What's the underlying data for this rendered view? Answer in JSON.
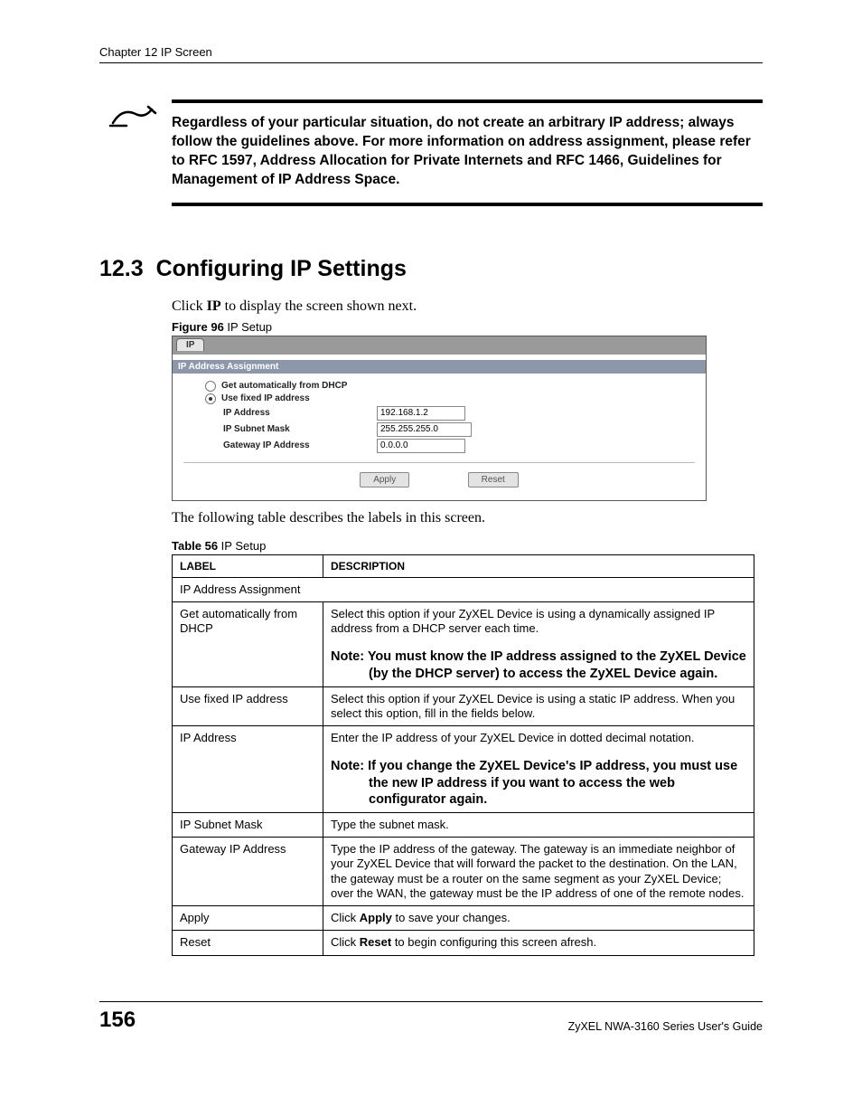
{
  "header": {
    "chapter": "Chapter 12 IP Screen"
  },
  "callout": {
    "text": "Regardless of your particular situation, do not create an arbitrary IP address; always follow the guidelines above. For more information on address assignment, please refer to RFC 1597, Address Allocation for Private Internets and RFC 1466, Guidelines for Management of IP Address Space."
  },
  "section": {
    "number": "12.3",
    "title": "Configuring IP Settings",
    "intro_pre": "Click ",
    "intro_bold": "IP",
    "intro_post": " to display the screen shown next."
  },
  "figure": {
    "caption_bold": "Figure 96",
    "caption_rest": "   IP Setup",
    "tab": "IP",
    "subheader": "IP Address Assignment",
    "radio1": "Get automatically from DHCP",
    "radio2": "Use fixed IP address",
    "field1_label": "IP Address",
    "field1_value": "192.168.1.2",
    "field2_label": "IP Subnet Mask",
    "field2_value": "255.255.255.0",
    "field3_label": "Gateway IP Address",
    "field3_value": "0.0.0.0",
    "btn_apply": "Apply",
    "btn_reset": "Reset"
  },
  "table_intro": "The following table describes the labels in this screen.",
  "table": {
    "caption_bold": "Table 56",
    "caption_rest": "   IP Setup",
    "head_label": "LABEL",
    "head_desc": "DESCRIPTION",
    "rows": {
      "span1": "IP Address Assignment",
      "r1_label": "Get automatically from DHCP",
      "r1_desc": "Select this option if your ZyXEL Device is using a dynamically assigned IP address from a DHCP server each time.",
      "r1_note": "Note: You must know the IP address assigned to the ZyXEL Device (by the DHCP server) to access the ZyXEL Device again.",
      "r2_label": "Use fixed IP address",
      "r2_desc": "Select this option if your ZyXEL Device is using a static IP address. When you select this option, fill in the fields below.",
      "r3_label": "IP Address",
      "r3_desc": "Enter the IP address of your ZyXEL Device in dotted decimal notation.",
      "r3_note": "Note: If you change the ZyXEL Device's IP address, you must use the new IP address if you want to access the web configurator again.",
      "r4_label": "IP Subnet Mask",
      "r4_desc": "Type the subnet mask.",
      "r5_label": "Gateway IP Address",
      "r5_desc": "Type the IP address of the gateway. The gateway is an immediate neighbor of your ZyXEL Device that will forward the packet to the destination. On the LAN, the gateway must be a router on the same segment as your ZyXEL Device; over the WAN, the gateway must be the IP address of one of the remote nodes.",
      "r6_label": "Apply",
      "r6_desc_pre": "Click ",
      "r6_desc_bold": "Apply",
      "r6_desc_post": " to save your changes.",
      "r7_label": "Reset",
      "r7_desc_pre": "Click ",
      "r7_desc_bold": "Reset",
      "r7_desc_post": " to begin configuring this screen afresh."
    }
  },
  "footer": {
    "page": "156",
    "guide": "ZyXEL NWA-3160 Series User's Guide"
  }
}
